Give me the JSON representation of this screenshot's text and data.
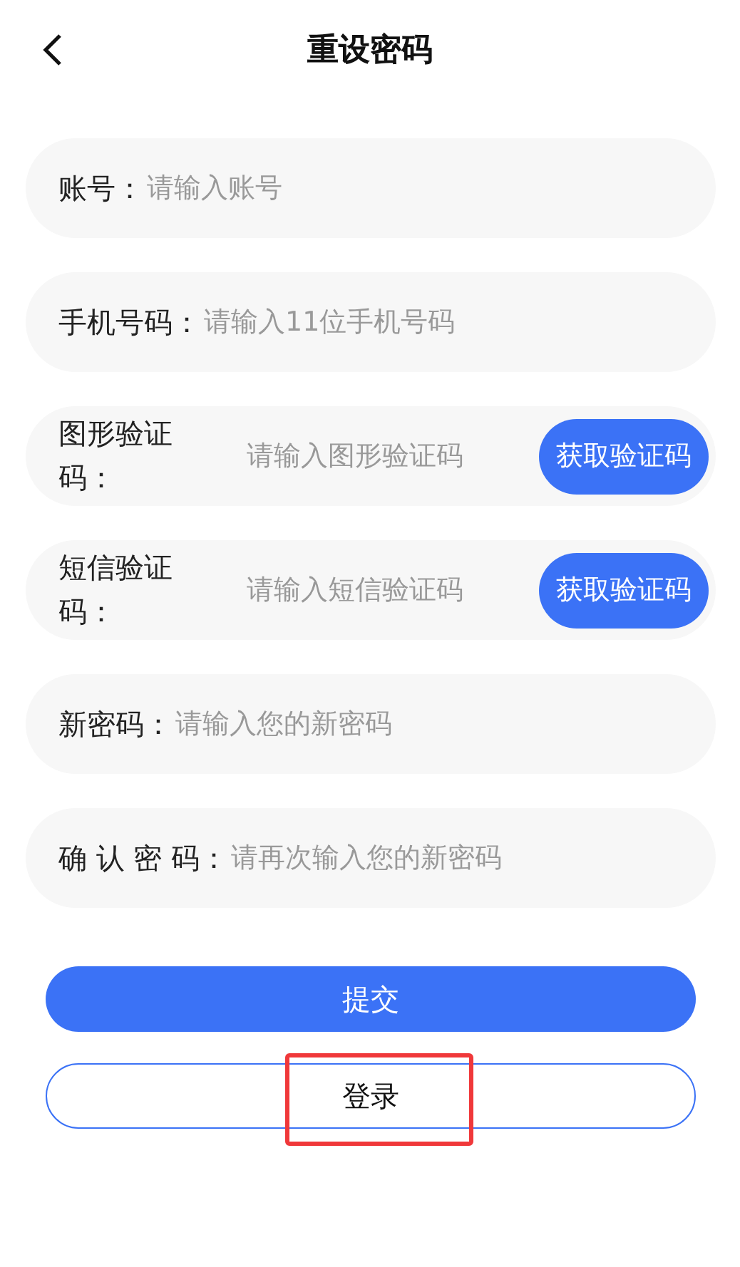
{
  "header": {
    "title": "重设密码"
  },
  "fields": [
    {
      "kind": "text",
      "label": "账号：",
      "placeholder": "请输入账号"
    },
    {
      "kind": "text",
      "label": "手机号码：",
      "placeholder": "请输入11位手机号码"
    },
    {
      "kind": "code",
      "label": "图形验证码：",
      "placeholder": "请输入图形验证码",
      "button": "获取验证码"
    },
    {
      "kind": "code",
      "label": "短信验证码：",
      "placeholder": "请输入短信验证码",
      "button": "获取验证码"
    },
    {
      "kind": "text",
      "label": "新密码：",
      "placeholder": "请输入您的新密码"
    },
    {
      "kind": "text",
      "label": "确 认 密 码：",
      "placeholder": "请再次输入您的新密码"
    }
  ],
  "submit_button": {
    "label": "提交"
  },
  "login_button": {
    "label": "登录",
    "highlighted": true
  }
}
